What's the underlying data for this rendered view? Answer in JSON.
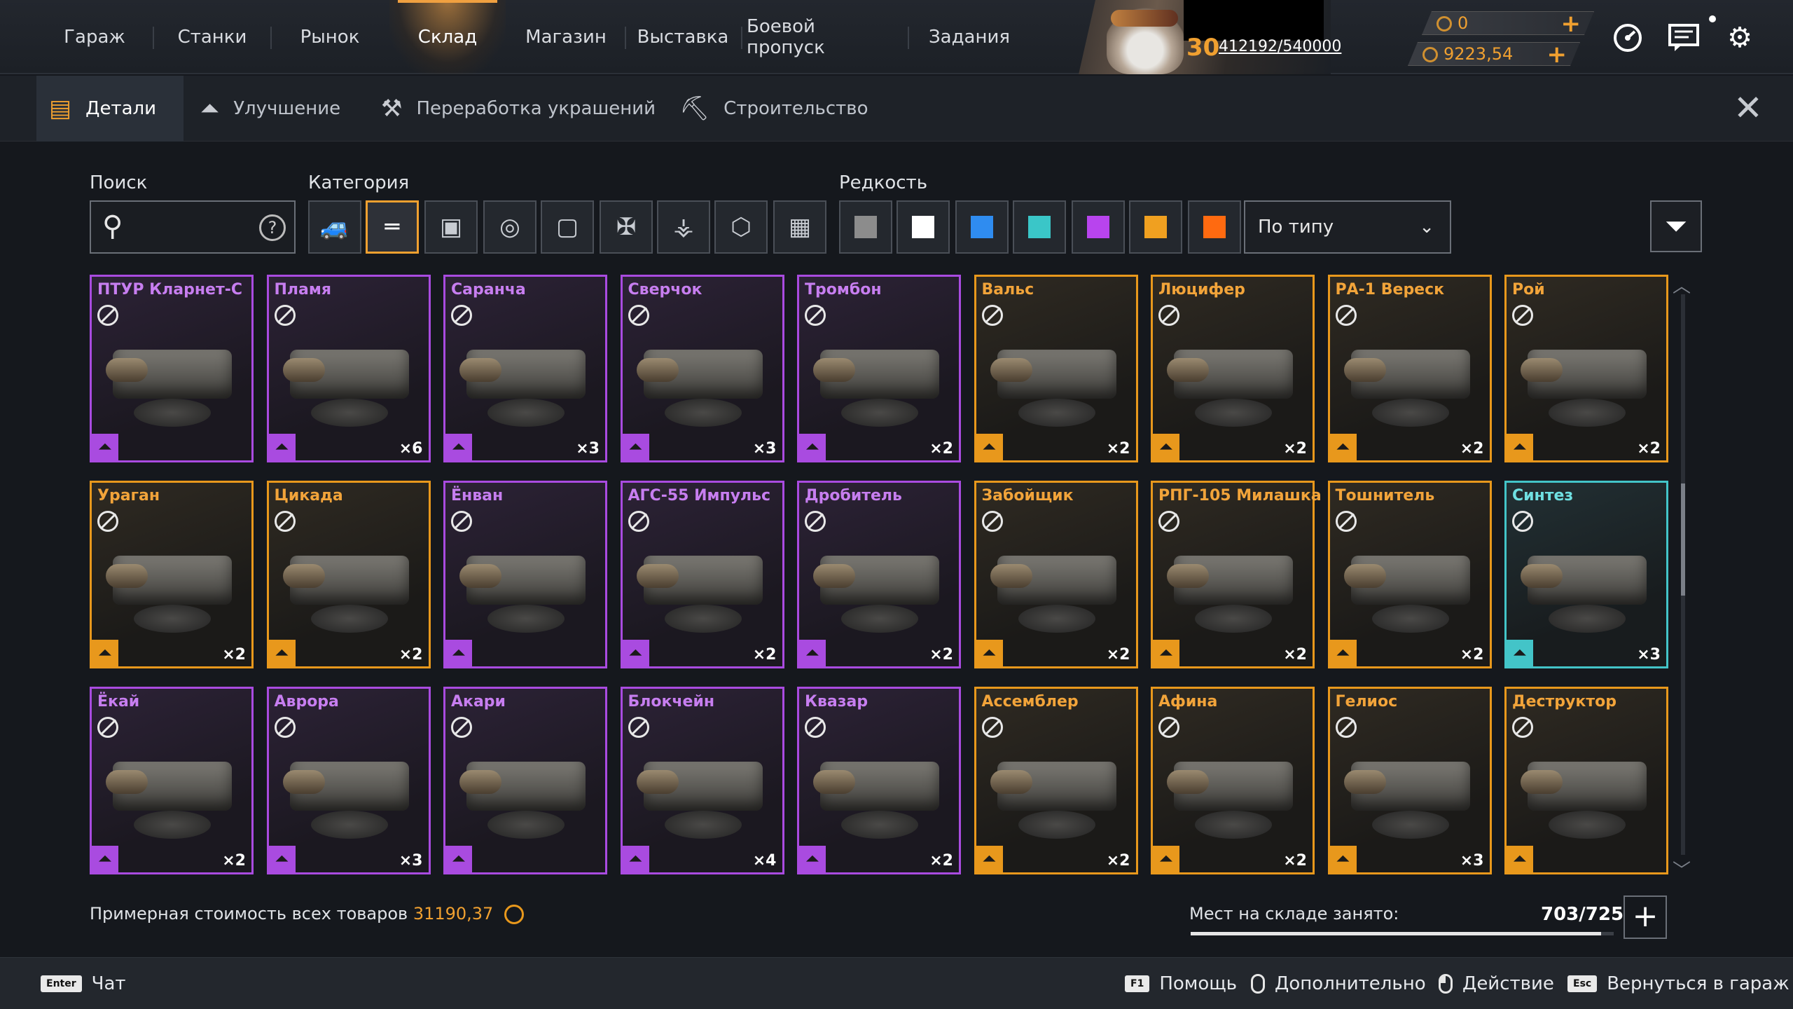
{
  "nav": {
    "tabs": [
      "Гараж",
      "Станки",
      "Рынок",
      "Склад",
      "Магазин",
      "Выставка",
      "Боевой пропуск",
      "Задания"
    ],
    "active": "Склад"
  },
  "player": {
    "level": "30",
    "xp": "412192/540000"
  },
  "currency": {
    "coins": "0",
    "credits": "9223,54"
  },
  "subtabs": {
    "items": [
      "Детали",
      "Улучшение",
      "Переработка украшений",
      "Строительство"
    ],
    "active": "Детали"
  },
  "filters": {
    "search_label": "Поиск",
    "search_placeholder": "",
    "category_label": "Категория",
    "rarity_label": "Редкость",
    "categories": [
      "car-icon",
      "weapon-icon",
      "cabin-icon",
      "wheel-icon",
      "frame-icon",
      "decor-icon",
      "paint-icon",
      "module-icon",
      "all-icon"
    ],
    "selected_category": "weapon-icon",
    "rarity_colors": [
      "#8c8c8c",
      "#ffffff",
      "#2f8cf0",
      "#3ac6c8",
      "#b844ee",
      "#f0a020",
      "#ff6a10"
    ],
    "sort_label": "По типу"
  },
  "items": [
    {
      "name": "ПТУР Кларнет-С",
      "rarity": "epic",
      "count": ""
    },
    {
      "name": "Пламя",
      "rarity": "epic",
      "count": "×6"
    },
    {
      "name": "Саранча",
      "rarity": "epic",
      "count": "×3"
    },
    {
      "name": "Сверчок",
      "rarity": "epic",
      "count": "×3"
    },
    {
      "name": "Тромбон",
      "rarity": "epic",
      "count": "×2"
    },
    {
      "name": "Вальс",
      "rarity": "legendary",
      "count": "×2"
    },
    {
      "name": "Люцифер",
      "rarity": "legendary",
      "count": "×2"
    },
    {
      "name": "РА-1 Вереск",
      "rarity": "legendary",
      "count": "×2"
    },
    {
      "name": "Рой",
      "rarity": "legendary",
      "count": "×2"
    },
    {
      "name": "Ураган",
      "rarity": "legendary",
      "count": "×2"
    },
    {
      "name": "Цикада",
      "rarity": "legendary",
      "count": "×2"
    },
    {
      "name": "Ёнван",
      "rarity": "epic",
      "count": ""
    },
    {
      "name": "АГС-55 Импульс",
      "rarity": "epic",
      "count": "×2"
    },
    {
      "name": "Дробитель",
      "rarity": "epic",
      "count": "×2"
    },
    {
      "name": "Забойщик",
      "rarity": "legendary",
      "count": "×2"
    },
    {
      "name": "РПГ-105 Милашка",
      "rarity": "legendary",
      "count": "×2"
    },
    {
      "name": "Тошнитель",
      "rarity": "legendary",
      "count": "×2"
    },
    {
      "name": "Синтез",
      "rarity": "relic",
      "count": "×3"
    },
    {
      "name": "Ёкай",
      "rarity": "epic",
      "count": "×2"
    },
    {
      "name": "Аврора",
      "rarity": "epic",
      "count": "×3"
    },
    {
      "name": "Акари",
      "rarity": "epic",
      "count": ""
    },
    {
      "name": "Блокчейн",
      "rarity": "epic",
      "count": "×4"
    },
    {
      "name": "Квазар",
      "rarity": "epic",
      "count": "×2"
    },
    {
      "name": "Ассемблер",
      "rarity": "legendary",
      "count": "×2"
    },
    {
      "name": "Афина",
      "rarity": "legendary",
      "count": "×2"
    },
    {
      "name": "Гелиос",
      "rarity": "legendary",
      "count": "×3"
    },
    {
      "name": "Деструктор",
      "rarity": "legendary",
      "count": ""
    }
  ],
  "status": {
    "cost_label": "Примерная стоимость всех товаров",
    "cost_value": "31190,37",
    "storage_label": "Мест на складе занято:",
    "storage_value": "703/725",
    "storage_fraction": 0.9697
  },
  "footer": [
    {
      "key": "Enter",
      "label": "Чат"
    },
    {
      "key": "F1",
      "label": "Помощь"
    },
    {
      "key": "mouse-right",
      "label": "Дополнительно"
    },
    {
      "key": "mouse-left",
      "label": "Действие"
    },
    {
      "key": "Esc",
      "label": "Вернуться в гараж"
    }
  ],
  "colors": {
    "accent": "#f0a030",
    "epic": "#a94be0",
    "legendary": "#e8981c",
    "relic": "#43c4c8"
  }
}
